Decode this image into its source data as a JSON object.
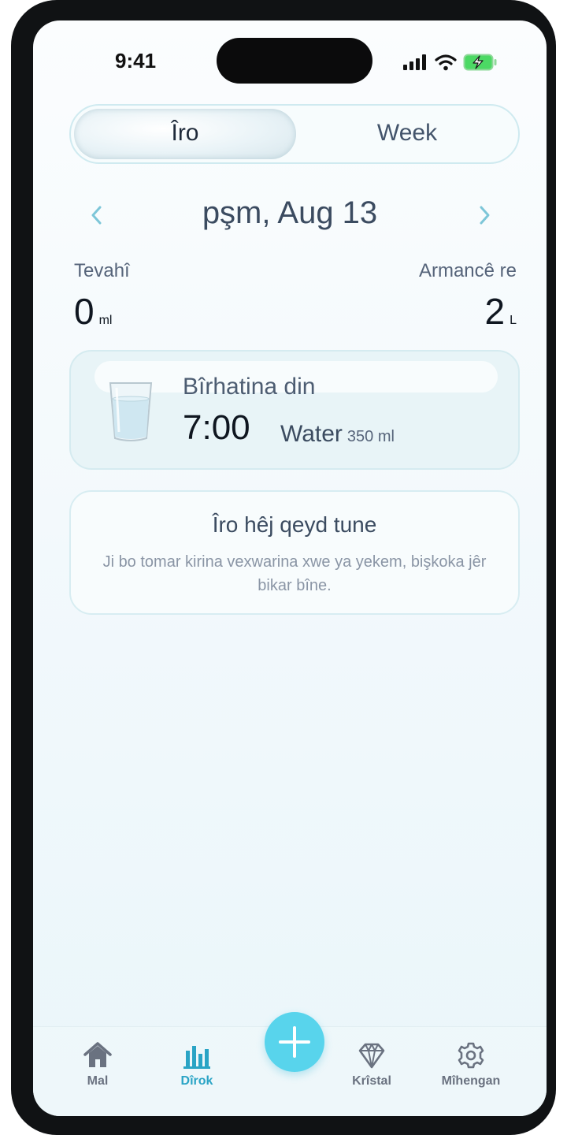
{
  "status": {
    "time": "9:41"
  },
  "segment": {
    "today_label": "Îro",
    "week_label": "Week"
  },
  "date": {
    "title": "pşm, Aug 13"
  },
  "stats": {
    "total_label": "Tevahî",
    "total_value": "0",
    "total_unit": "ml",
    "goal_label": "Armancê re",
    "goal_value": "2",
    "goal_unit": "L"
  },
  "next_drink": {
    "title": "Bîrhatina din",
    "time": "7:00",
    "drink": "Water",
    "amount": "350 ml"
  },
  "empty_state": {
    "title": "Îro hêj qeyd tune",
    "description": "Ji bo tomar kirina vexwarina xwe ya yekem, bişkoka jêr bikar bîne."
  },
  "tabs": [
    {
      "label": "Mal",
      "icon": "home-icon"
    },
    {
      "label": "Dîrok",
      "icon": "bar-chart-icon",
      "active": true
    },
    {
      "label": "Krîstal",
      "icon": "diamond-icon"
    },
    {
      "label": "Mîhengan",
      "icon": "gear-icon"
    }
  ],
  "colors": {
    "accent": "#58d4ec",
    "active_tab": "#2aa4c5",
    "text_dark": "#0f1620"
  }
}
